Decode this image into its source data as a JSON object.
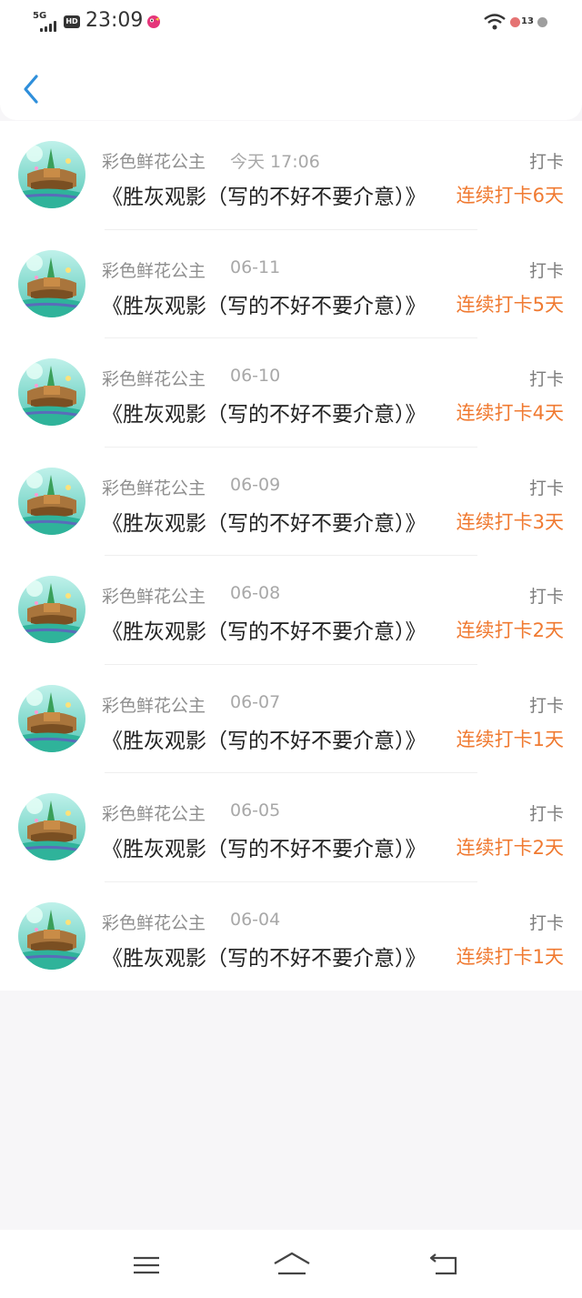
{
  "status_bar": {
    "network": "5G",
    "hd": "HD",
    "time": "23:09",
    "notification_count": "13",
    "icons": [
      "signal-icon",
      "hd-icon",
      "app-notification-icon",
      "wifi-icon",
      "notification-dot-icon"
    ]
  },
  "header": {
    "back_icon": "chevron-left-icon",
    "accent_color": "#2f8fdb"
  },
  "checkins": [
    {
      "user": "彩色鲜花公主",
      "date": "今天 17:06",
      "tag": "打卡",
      "title": "《胜灰观影（写的不好不要介意）》",
      "streak": "连续打卡6天"
    },
    {
      "user": "彩色鲜花公主",
      "date": "06-11",
      "tag": "打卡",
      "title": "《胜灰观影（写的不好不要介意）》",
      "streak": "连续打卡5天"
    },
    {
      "user": "彩色鲜花公主",
      "date": "06-10",
      "tag": "打卡",
      "title": "《胜灰观影（写的不好不要介意）》",
      "streak": "连续打卡4天"
    },
    {
      "user": "彩色鲜花公主",
      "date": "06-09",
      "tag": "打卡",
      "title": "《胜灰观影（写的不好不要介意）》",
      "streak": "连续打卡3天"
    },
    {
      "user": "彩色鲜花公主",
      "date": "06-08",
      "tag": "打卡",
      "title": "《胜灰观影（写的不好不要介意）》",
      "streak": "连续打卡2天"
    },
    {
      "user": "彩色鲜花公主",
      "date": "06-07",
      "tag": "打卡",
      "title": "《胜灰观影（写的不好不要介意）》",
      "streak": "连续打卡1天"
    },
    {
      "user": "彩色鲜花公主",
      "date": "06-05",
      "tag": "打卡",
      "title": "《胜灰观影（写的不好不要介意）》",
      "streak": "连续打卡2天"
    },
    {
      "user": "彩色鲜花公主",
      "date": "06-04",
      "tag": "打卡",
      "title": "《胜灰观影（写的不好不要介意）》",
      "streak": "连续打卡1天"
    }
  ],
  "colors": {
    "streak": "#f07a31",
    "background": "#f7f6f8"
  },
  "bottom_nav": {
    "icons": [
      "menu-icon",
      "home-icon",
      "back-icon"
    ]
  }
}
